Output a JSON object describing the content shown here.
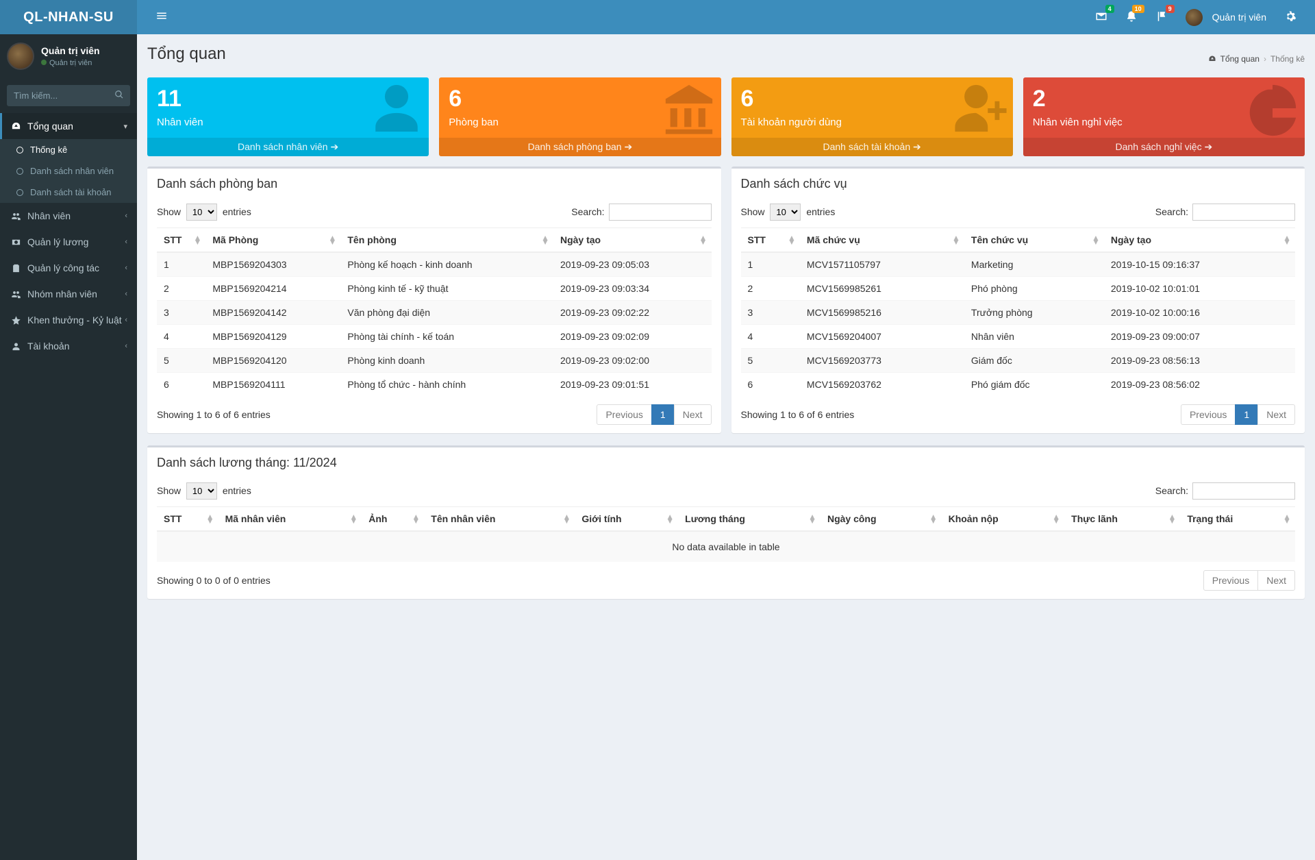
{
  "brand": "QL-NHAN-SU",
  "header": {
    "user_name": "Quản trị viên",
    "mail_badge": "4",
    "bell_badge": "10",
    "flag_badge": "9"
  },
  "sidebar": {
    "user_name": "Quản trị viên",
    "user_role": "Quản trị viên",
    "search_placeholder": "Tìm kiếm...",
    "menu": {
      "overview": "Tổng quan",
      "stats": "Thống kê",
      "emp_list": "Danh sách nhân viên",
      "acc_list": "Danh sách tài khoản",
      "staff": "Nhân viên",
      "salary": "Quản lý lương",
      "work": "Quản lý công tác",
      "team": "Nhóm nhân viên",
      "reward": "Khen thưởng - Kỷ luật",
      "account": "Tài khoản"
    }
  },
  "page": {
    "title": "Tổng quan",
    "crumb_root": "Tổng quan",
    "crumb_active": "Thống kê"
  },
  "boxes": {
    "b1_value": "11",
    "b1_label": "Nhân viên",
    "b1_link": "Danh sách nhân viên ",
    "b2_value": "6",
    "b2_label": "Phòng ban",
    "b2_link": "Danh sách phòng ban ",
    "b3_value": "6",
    "b3_label": "Tài khoản người dùng",
    "b3_link": "Danh sách tài khoản ",
    "b4_value": "2",
    "b4_label": "Nhân viên nghỉ việc",
    "b4_link": "Danh sách nghỉ việc "
  },
  "dt": {
    "show": "Show",
    "entries_suffix": "entries",
    "page_size": "10",
    "search": "Search:",
    "prev": "Previous",
    "next": "Next",
    "page1": "1"
  },
  "dept": {
    "title": "Danh sách phòng ban",
    "cols": {
      "c1": "STT",
      "c2": "Mã Phòng",
      "c3": "Tên phòng",
      "c4": "Ngày tạo"
    },
    "rows": [
      {
        "stt": "1",
        "code": "MBP1569204303",
        "name": "Phòng kế hoạch - kinh doanh",
        "date": "2019-09-23 09:05:03"
      },
      {
        "stt": "2",
        "code": "MBP1569204214",
        "name": "Phòng kinh tế - kỹ thuật",
        "date": "2019-09-23 09:03:34"
      },
      {
        "stt": "3",
        "code": "MBP1569204142",
        "name": "Văn phòng đại diện",
        "date": "2019-09-23 09:02:22"
      },
      {
        "stt": "4",
        "code": "MBP1569204129",
        "name": "Phòng tài chính - kế toán",
        "date": "2019-09-23 09:02:09"
      },
      {
        "stt": "5",
        "code": "MBP1569204120",
        "name": "Phòng kinh doanh",
        "date": "2019-09-23 09:02:00"
      },
      {
        "stt": "6",
        "code": "MBP1569204111",
        "name": "Phòng tổ chức - hành chính",
        "date": "2019-09-23 09:01:51"
      }
    ],
    "info": "Showing 1 to 6 of 6 entries"
  },
  "pos": {
    "title": "Danh sách chức vụ",
    "cols": {
      "c1": "STT",
      "c2": "Mã chức vụ",
      "c3": "Tên chức vụ",
      "c4": "Ngày tạo"
    },
    "rows": [
      {
        "stt": "1",
        "code": "MCV1571105797",
        "name": "Marketing",
        "date": "2019-10-15 09:16:37"
      },
      {
        "stt": "2",
        "code": "MCV1569985261",
        "name": "Phó phòng",
        "date": "2019-10-02 10:01:01"
      },
      {
        "stt": "3",
        "code": "MCV1569985216",
        "name": "Trưởng phòng",
        "date": "2019-10-02 10:00:16"
      },
      {
        "stt": "4",
        "code": "MCV1569204007",
        "name": "Nhân viên",
        "date": "2019-09-23 09:00:07"
      },
      {
        "stt": "5",
        "code": "MCV1569203773",
        "name": "Giám đốc",
        "date": "2019-09-23 08:56:13"
      },
      {
        "stt": "6",
        "code": "MCV1569203762",
        "name": "Phó giám đốc",
        "date": "2019-09-23 08:56:02"
      }
    ],
    "info": "Showing 1 to 6 of 6 entries"
  },
  "salary": {
    "title": "Danh sách lương tháng: 11/2024",
    "cols": {
      "c1": "STT",
      "c2": "Mã nhân viên",
      "c3": "Ảnh",
      "c4": "Tên nhân viên",
      "c5": "Giới tính",
      "c6": "Lương tháng",
      "c7": "Ngày công",
      "c8": "Khoản nộp",
      "c9": "Thực lãnh",
      "c10": "Trạng thái"
    },
    "empty": "No data available in table",
    "info": "Showing 0 to 0 of 0 entries"
  }
}
